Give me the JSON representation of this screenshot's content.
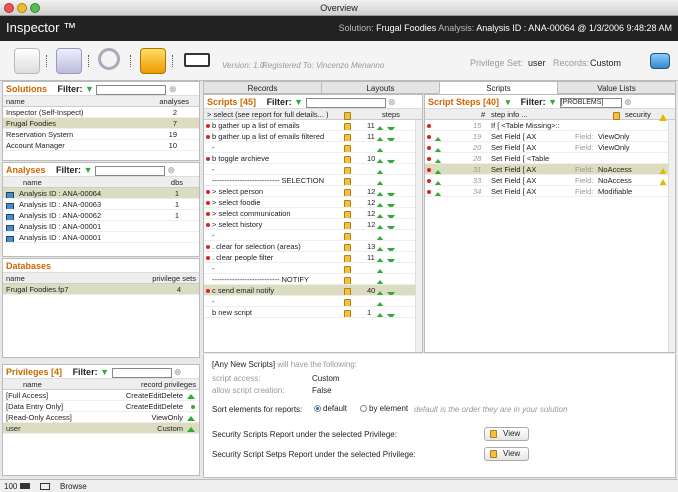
{
  "window": {
    "title": "Overview"
  },
  "header": {
    "app_name": "Inspector ™",
    "solution_label": "Solution:",
    "solution": "Frugal Foodies",
    "analysis_label": "Analysis:",
    "analysis": "Analysis ID : ANA-00064 @ 1/3/2006 9:48:28 AM"
  },
  "toolbar": {
    "version": "Version: 1.0",
    "registered": "Registered To: Vincenzo Menanno",
    "privilege_label": "Privilege Set:",
    "privilege_value": "user",
    "records_label": "Records:",
    "records_value": "Custom"
  },
  "solutions": {
    "title": "Solutions",
    "filter_label": "Filter:",
    "col_name": "name",
    "col_analyses": "analyses",
    "rows": [
      {
        "name": "Inspector (Self-Inspect)",
        "analyses": "2"
      },
      {
        "name": "Frugal Foodies",
        "analyses": "7"
      },
      {
        "name": "Reservation System",
        "analyses": "19"
      },
      {
        "name": "Account Manager",
        "analyses": "10"
      }
    ]
  },
  "analyses": {
    "title": "Analyses",
    "filter_label": "Filter:",
    "col_name": "name",
    "col_dbs": "dbs",
    "rows": [
      {
        "name": "Analysis ID : ANA-00064",
        "dbs": "1"
      },
      {
        "name": "Analysis ID : ANA-00063",
        "dbs": "1"
      },
      {
        "name": "Analysis ID : ANA-00062",
        "dbs": "1"
      },
      {
        "name": "Analysis ID : ANA-00001",
        "dbs": ""
      },
      {
        "name": "Analysis ID : ANA-00001",
        "dbs": ""
      }
    ]
  },
  "databases": {
    "title": "Databases",
    "col_name": "name",
    "col_priv": "privilege sets",
    "rows": [
      {
        "name": "Frugal Foodies.fp7",
        "priv": "4"
      }
    ]
  },
  "privileges": {
    "title": "Privileges",
    "count": "[4]",
    "filter_label": "Filter:",
    "col_name": "name",
    "col_priv": "record privileges",
    "rows": [
      {
        "name": "[Full Access]",
        "priv": "CreateEditDelete"
      },
      {
        "name": "[Data Entry Only]",
        "priv": "CreateEditDelete"
      },
      {
        "name": "[Read-Only Access]",
        "priv": "ViewOnly"
      },
      {
        "name": "user",
        "priv": "Custom"
      }
    ]
  },
  "tabs": [
    {
      "label": "Records"
    },
    {
      "label": "Layouts"
    },
    {
      "label": "Scripts"
    },
    {
      "label": "Value Lists"
    }
  ],
  "scripts": {
    "title": "Scripts",
    "count": "[45]",
    "filter_label": "Filter:",
    "col_name": "> select (see report for full details... )",
    "col_steps": "steps",
    "rows": [
      {
        "name": "b gather up a list of emails",
        "steps": "11",
        "dot": true
      },
      {
        "name": "b gather up a list of emails filtered",
        "steps": "11",
        "dot": true
      },
      {
        "name": "-",
        "steps": "",
        "dot": false
      },
      {
        "name": "b toggle archieve",
        "steps": "10",
        "dot": true
      },
      {
        "name": "-",
        "steps": "",
        "dot": false
      },
      {
        "name": "--------------------------- SELECTION",
        "steps": "",
        "dot": false
      },
      {
        "name": "> select person",
        "steps": "12",
        "dot": true
      },
      {
        "name": "> select foodie",
        "steps": "12",
        "dot": true
      },
      {
        "name": "> select communication",
        "steps": "12",
        "dot": true
      },
      {
        "name": "> select history",
        "steps": "12",
        "dot": true
      },
      {
        "name": "-",
        "steps": "",
        "dot": false
      },
      {
        "name": ". clear for selection (areas)",
        "steps": "13",
        "dot": true
      },
      {
        "name": ". clear people filter",
        "steps": "11",
        "dot": true
      },
      {
        "name": "-",
        "steps": "",
        "dot": false
      },
      {
        "name": "--------------------------- NOTIFY",
        "steps": "",
        "dot": false
      },
      {
        "name": "c send email notify",
        "steps": "40",
        "dot": true
      },
      {
        "name": "-",
        "steps": "",
        "dot": false
      },
      {
        "name": "b new script",
        "steps": "1",
        "dot": false
      }
    ]
  },
  "steps": {
    "title": "Script Steps",
    "count": "[40]",
    "filter_label": "Filter:",
    "filter_value": "[PROBLEMS]",
    "col_num": "#",
    "col_info": "step info ...",
    "col_security": "security",
    "rows": [
      {
        "num": "15",
        "info": "If [ <Table Missing>::",
        "field_label": "",
        "field_value": "",
        "warn": false
      },
      {
        "num": "19",
        "info": "Set Field [ AX",
        "field_label": "Field:",
        "field_value": "ViewOnly",
        "warn": false
      },
      {
        "num": "20",
        "info": "Set Field [ AX",
        "field_label": "Field:",
        "field_value": "ViewOnly",
        "warn": false
      },
      {
        "num": "28",
        "info": "Set Field [ <Table",
        "field_label": "",
        "field_value": "",
        "warn": false
      },
      {
        "num": "31",
        "info": "Set Field [ AX",
        "field_label": "Field:",
        "field_value": "NoAccess",
        "warn": true
      },
      {
        "num": "33",
        "info": "Set Field [ AX",
        "field_label": "Field:",
        "field_value": "NoAccess",
        "warn": true
      },
      {
        "num": "34",
        "info": "Set Field [ AX",
        "field_label": "Field:",
        "field_value": "Modifiable",
        "warn": false
      }
    ]
  },
  "details": {
    "any_new": "[Any New Scripts]",
    "any_new_rest": "will have the following:",
    "script_access_label": "script access:",
    "script_access_value": "Custom",
    "allow_label": "allow script creation:",
    "allow_value": "False",
    "sort_label": "Sort elements for reports:",
    "opt_default": "default",
    "opt_element": "by element",
    "sort_note": "default is the order they are in your solution",
    "report1": "Security Scripts Report under the selected Privilege:",
    "report2": "Security Script Setps Report under the selected Privilege:",
    "view_label": "View"
  },
  "statusbar": {
    "zoom": "100",
    "mode": "Browse"
  }
}
